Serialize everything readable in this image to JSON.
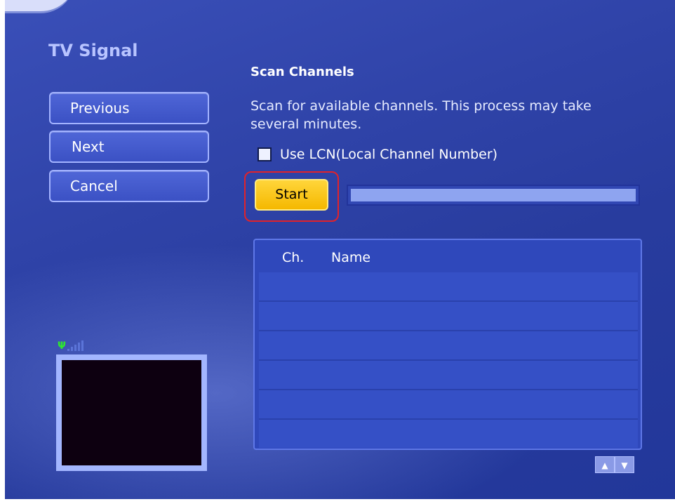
{
  "app": {
    "page_title": "TV Signal"
  },
  "nav": {
    "previous_label": "Previous",
    "next_label": "Next",
    "cancel_label": "Cancel"
  },
  "scan": {
    "title": "Scan Channels",
    "description": "Scan for available channels. This process may take several minutes.",
    "lcn_label": "Use LCN(Local Channel Number)",
    "lcn_checked": false,
    "start_label": "Start",
    "progress_percent": 0
  },
  "table": {
    "headers": {
      "channel": "Ch.",
      "name": "Name"
    },
    "rows": []
  },
  "icons": {
    "signal": "signal-strength-icon",
    "scroll_up": "chevron-up-icon",
    "scroll_down": "chevron-down-icon"
  },
  "colors": {
    "accent": "#ffd53a",
    "highlight": "#e2222a",
    "background": "#2f43a8"
  }
}
